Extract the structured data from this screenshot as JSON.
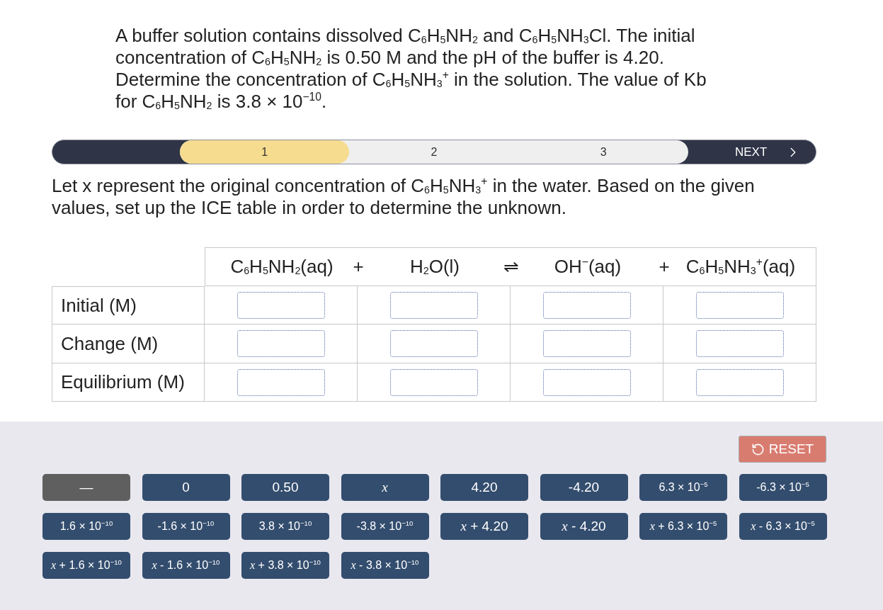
{
  "question": {
    "text": "A buffer solution contains dissolved C$_{6}$H$_{5}$NH$_{2}$ and C$_{6}$H$_{5}$NH$_{3}$Cl. The initial concentration of C$_{6}$H$_{5}$NH$_{2}$ is 0.50 M and the pH of the buffer is 4.20. Determine the concentration of C$_{6}$H$_{5}$NH$_{3}$$^{+}$ in the solution. The value of Kb for C$_{6}$H$_{5}$NH$_{2}$ is 3.8 × 10$^{−10}$."
  },
  "stepper": {
    "steps": [
      {
        "label": "1",
        "selected": true
      },
      {
        "label": "2",
        "selected": false
      },
      {
        "label": "3",
        "selected": false
      }
    ],
    "next": {
      "label": "NEXT"
    }
  },
  "instruction": {
    "text": "Let x represent the original concentration of C$_{6}$H$_{5}$NH$_{3}$$^{+}$ in the water. Based on the given values, set up the ICE table in order to determine the unknown."
  },
  "ice_table": {
    "header": [
      {
        "kind": "species",
        "text": "C$_{6}$H$_{5}$NH$_{2}$(aq)"
      },
      {
        "kind": "operator",
        "text": "+"
      },
      {
        "kind": "species",
        "text": "H$_{2}$O(l)"
      },
      {
        "kind": "operator",
        "text": "⇌"
      },
      {
        "kind": "species",
        "text": "OH$^{−}$(aq)"
      },
      {
        "kind": "operator",
        "text": "+"
      },
      {
        "kind": "species",
        "text": "C$_{6}$H$_{5}$NH$_{3}$$^{+}$(aq)"
      }
    ],
    "rows": [
      {
        "label": "Initial (M)"
      },
      {
        "label": "Change (M)"
      },
      {
        "label": "Equilibrium (M)"
      }
    ]
  },
  "reset_button": {
    "label": "RESET"
  },
  "answer_tiles": [
    {
      "kind": "blank",
      "text": "—"
    },
    {
      "kind": "value",
      "text": "0"
    },
    {
      "kind": "value",
      "text": "0.50"
    },
    {
      "kind": "variable",
      "text": "x"
    },
    {
      "kind": "value",
      "text": "4.20"
    },
    {
      "kind": "value",
      "text": "-4.20"
    },
    {
      "kind": "scientific",
      "text": "6.3 × 10$^{−5}$"
    },
    {
      "kind": "scientific",
      "text": "-6.3 × 10$^{−5}$"
    },
    {
      "kind": "scientific",
      "text": "1.6 × 10$^{−10}$"
    },
    {
      "kind": "scientific",
      "text": "-1.6 × 10$^{−10}$"
    },
    {
      "kind": "scientific",
      "text": "3.8 × 10$^{−10}$"
    },
    {
      "kind": "scientific",
      "text": "-3.8 × 10$^{−10}$"
    },
    {
      "kind": "value",
      "text": "*x* + 4.20"
    },
    {
      "kind": "value",
      "text": "*x* - 4.20"
    },
    {
      "kind": "scientific",
      "text": "*x* + 6.3 × 10$^{−5}$"
    },
    {
      "kind": "scientific",
      "text": "*x* - 6.3 × 10$^{−5}$"
    },
    {
      "kind": "scientific",
      "text": "*x* + 1.6 × 10$^{−10}$"
    },
    {
      "kind": "scientific",
      "text": "*x* - 1.6 × 10$^{−10}$"
    },
    {
      "kind": "scientific",
      "text": "*x* + 3.8 × 10$^{−10}$"
    },
    {
      "kind": "scientific",
      "text": "*x* - 3.8 × 10$^{−10}$"
    }
  ]
}
